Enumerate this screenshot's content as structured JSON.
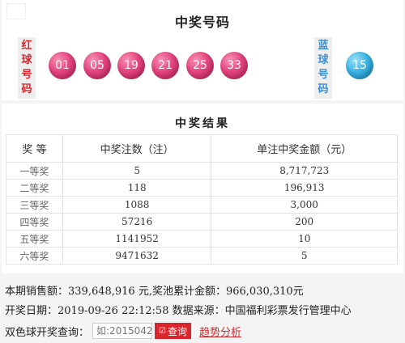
{
  "draw": {
    "title": "中奖号码",
    "red_label": [
      "红",
      "球",
      "号",
      "码"
    ],
    "blue_label": [
      "蓝",
      "球",
      "号",
      "码"
    ],
    "red_balls": [
      "01",
      "05",
      "19",
      "21",
      "25",
      "33"
    ],
    "blue_ball": "15",
    "colors": {
      "red_accent": "#d9262c",
      "blue_accent": "#3a8fd6",
      "red_ball": "#e4447e",
      "blue_ball": "#3bb4e3"
    }
  },
  "results": {
    "title": "中奖结果",
    "headers": [
      "奖 等",
      "中奖注数（注）",
      "单注中奖金额（元）"
    ],
    "rows": [
      {
        "level": "一等奖",
        "count": "5",
        "amount": "8,717,723"
      },
      {
        "level": "二等奖",
        "count": "118",
        "amount": "196,913"
      },
      {
        "level": "三等奖",
        "count": "1088",
        "amount": "3,000"
      },
      {
        "level": "四等奖",
        "count": "57216",
        "amount": "200"
      },
      {
        "level": "五等奖",
        "count": "1141952",
        "amount": "10"
      },
      {
        "level": "六等奖",
        "count": "9471632",
        "amount": "5"
      }
    ]
  },
  "info": {
    "sales_line": "本期销售额：339,648,916 元,奖池累计金额：966,030,310元",
    "date_line": "开奖日期：2019-09-26 22:12:58 数据来源：中国福利彩票发行管理中心"
  },
  "query": {
    "label": "双色球开奖查询：",
    "placeholder": "如:2015042",
    "button_label": "查询",
    "button_icon": "search-icon",
    "trend_link": "趋势分析"
  }
}
